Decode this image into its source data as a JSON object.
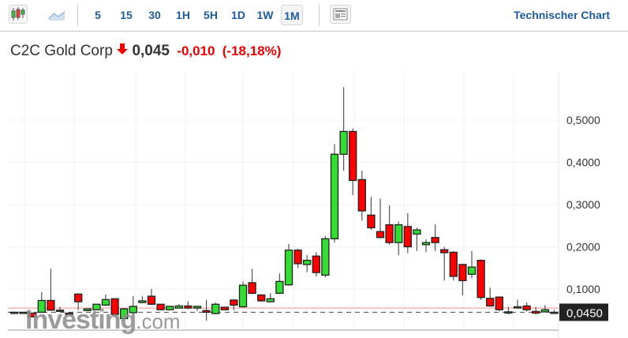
{
  "toolbar": {
    "chart_type_icons": [
      "candlestick-icon",
      "area-chart-icon"
    ],
    "timeframes": [
      "5",
      "15",
      "30",
      "1H",
      "5H",
      "1D",
      "1W",
      "1M"
    ],
    "active_timeframe": "1M",
    "layout_icon": "news-layout-icon",
    "technical_chart_link": "Technischer Chart"
  },
  "instrument": {
    "name": "C2C Gold Corp",
    "direction_icon": "arrow-down-icon",
    "price": "0,045",
    "change": "-0,010",
    "change_pct": "(-18,18%)"
  },
  "colors": {
    "up": "#33dd33",
    "down": "#ff0000",
    "link": "#1e5a9e",
    "prev_close_line": "#f5b5b5"
  },
  "watermark": {
    "brand": "Investing",
    "suffix": ".com"
  },
  "chart_data": {
    "type": "candlestick",
    "y_ticks": [
      "0,5000",
      "0,4000",
      "0,3000",
      "0,2000",
      "0,1000"
    ],
    "y_tick_values": [
      0.5,
      0.4,
      0.3,
      0.2,
      0.1
    ],
    "ylim": [
      0,
      0.6
    ],
    "current_price_label": "0,0450",
    "current_price": 0.045,
    "previous_close": 0.055,
    "grid": true,
    "ohlc": [
      [
        0.045,
        0.047,
        0.043,
        0.045
      ],
      [
        0.045,
        0.046,
        0.044,
        0.045
      ],
      [
        0.043,
        0.044,
        0.033,
        0.034
      ],
      [
        0.045,
        0.093,
        0.045,
        0.073
      ],
      [
        0.073,
        0.148,
        0.048,
        0.05
      ],
      [
        0.05,
        0.058,
        0.048,
        0.05
      ],
      [
        0.043,
        0.044,
        0.039,
        0.04
      ],
      [
        0.088,
        0.09,
        0.05,
        0.07
      ],
      [
        0.049,
        0.054,
        0.048,
        0.053
      ],
      [
        0.051,
        0.065,
        0.05,
        0.064
      ],
      [
        0.062,
        0.087,
        0.06,
        0.075
      ],
      [
        0.077,
        0.078,
        0.038,
        0.04
      ],
      [
        0.03,
        0.055,
        0.028,
        0.053
      ],
      [
        0.044,
        0.083,
        0.04,
        0.059
      ],
      [
        0.068,
        0.083,
        0.066,
        0.072
      ],
      [
        0.083,
        0.1,
        0.062,
        0.064
      ],
      [
        0.064,
        0.065,
        0.05,
        0.051
      ],
      [
        0.051,
        0.06,
        0.05,
        0.059
      ],
      [
        0.055,
        0.064,
        0.054,
        0.06
      ],
      [
        0.06,
        0.071,
        0.052,
        0.055
      ],
      [
        0.055,
        0.06,
        0.048,
        0.059
      ],
      [
        0.049,
        0.074,
        0.025,
        0.045
      ],
      [
        0.042,
        0.068,
        0.04,
        0.064
      ],
      [
        0.057,
        0.058,
        0.05,
        0.051
      ],
      [
        0.074,
        0.076,
        0.05,
        0.062
      ],
      [
        0.058,
        0.117,
        0.056,
        0.109
      ],
      [
        0.115,
        0.148,
        0.088,
        0.09
      ],
      [
        0.086,
        0.088,
        0.07,
        0.072
      ],
      [
        0.07,
        0.09,
        0.068,
        0.077
      ],
      [
        0.09,
        0.137,
        0.088,
        0.118
      ],
      [
        0.11,
        0.207,
        0.108,
        0.192
      ],
      [
        0.192,
        0.195,
        0.15,
        0.16
      ],
      [
        0.158,
        0.18,
        0.14,
        0.168
      ],
      [
        0.178,
        0.187,
        0.13,
        0.139
      ],
      [
        0.133,
        0.225,
        0.128,
        0.219
      ],
      [
        0.219,
        0.443,
        0.21,
        0.419
      ],
      [
        0.419,
        0.578,
        0.38,
        0.473
      ],
      [
        0.473,
        0.48,
        0.322,
        0.357
      ],
      [
        0.359,
        0.38,
        0.262,
        0.285
      ],
      [
        0.275,
        0.318,
        0.24,
        0.245
      ],
      [
        0.236,
        0.314,
        0.22,
        0.222
      ],
      [
        0.252,
        0.298,
        0.205,
        0.21
      ],
      [
        0.21,
        0.26,
        0.18,
        0.252
      ],
      [
        0.248,
        0.28,
        0.185,
        0.2
      ],
      [
        0.23,
        0.245,
        0.19,
        0.24
      ],
      [
        0.205,
        0.218,
        0.187,
        0.21
      ],
      [
        0.222,
        0.253,
        0.19,
        0.21
      ],
      [
        0.193,
        0.2,
        0.12,
        0.186
      ],
      [
        0.187,
        0.19,
        0.12,
        0.13
      ],
      [
        0.158,
        0.16,
        0.085,
        0.12
      ],
      [
        0.135,
        0.19,
        0.125,
        0.152
      ],
      [
        0.168,
        0.17,
        0.074,
        0.08
      ],
      [
        0.078,
        0.103,
        0.058,
        0.06
      ],
      [
        0.081,
        0.082,
        0.047,
        0.051
      ],
      [
        0.046,
        0.058,
        0.04,
        0.046
      ],
      [
        0.058,
        0.075,
        0.056,
        0.058
      ],
      [
        0.06,
        0.068,
        0.047,
        0.051
      ],
      [
        0.047,
        0.058,
        0.04,
        0.043
      ],
      [
        0.046,
        0.062,
        0.045,
        0.051
      ],
      [
        0.045,
        0.051,
        0.044,
        0.045
      ]
    ]
  }
}
